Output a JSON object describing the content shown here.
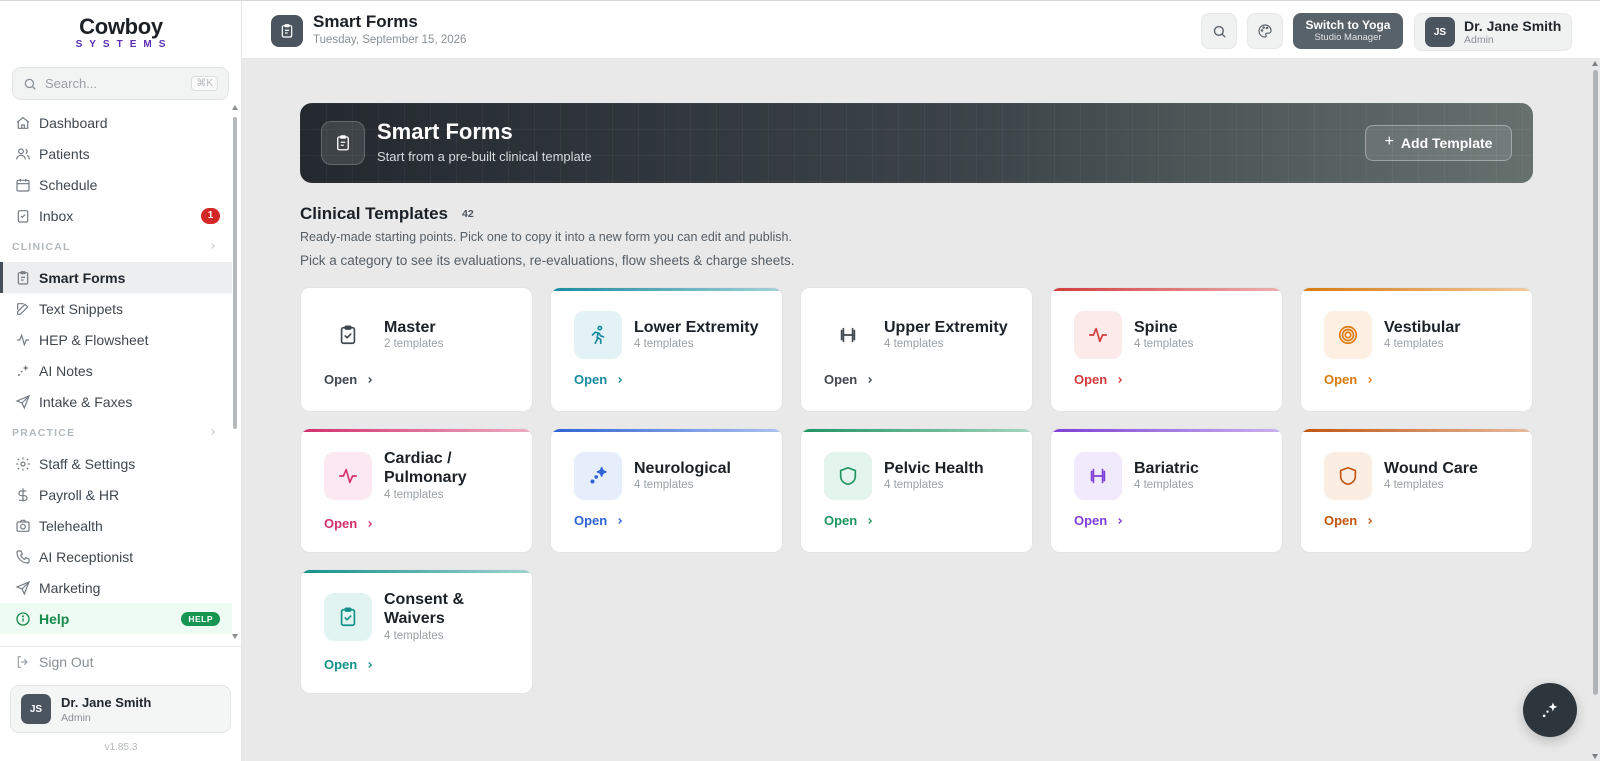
{
  "brand": {
    "name": "Cowboy",
    "sub": "SYSTEMS"
  },
  "search": {
    "placeholder": "Search...",
    "shortcut": "⌘K"
  },
  "nav": {
    "top": [
      {
        "label": "Dashboard",
        "icon": "home-icon"
      },
      {
        "label": "Patients",
        "icon": "users-icon"
      },
      {
        "label": "Schedule",
        "icon": "calendar-icon"
      },
      {
        "label": "Inbox",
        "icon": "inbox-icon",
        "badge": "1"
      }
    ],
    "clinical_label": "CLINICAL",
    "clinical": [
      {
        "label": "Smart Forms",
        "icon": "clipboard-icon",
        "active": true
      },
      {
        "label": "Text Snippets",
        "icon": "edit-icon"
      },
      {
        "label": "HEP & Flowsheet",
        "icon": "activity-icon"
      },
      {
        "label": "AI Notes",
        "icon": "sparkle-icon"
      },
      {
        "label": "Intake & Faxes",
        "icon": "send-icon"
      }
    ],
    "practice_label": "PRACTICE",
    "practice": [
      {
        "label": "Staff & Settings",
        "icon": "gear-icon"
      },
      {
        "label": "Payroll & HR",
        "icon": "dollar-icon"
      },
      {
        "label": "Telehealth",
        "icon": "camera-icon"
      },
      {
        "label": "AI Receptionist",
        "icon": "phone-icon"
      },
      {
        "label": "Marketing",
        "icon": "send-icon"
      }
    ],
    "help": {
      "label": "Help",
      "badge": "HELP"
    },
    "signout": "Sign Out"
  },
  "user": {
    "initials": "JS",
    "name": "Dr. Jane Smith",
    "role": "Admin"
  },
  "version": "v1.85.3",
  "topbar": {
    "title": "Smart Forms",
    "date": "Tuesday, September 15, 2026",
    "switch_line1": "Switch to Yoga",
    "switch_line2": "Studio Manager"
  },
  "hero": {
    "title": "Smart Forms",
    "subtitle": "Start from a pre-built clinical template",
    "add_label": "Add Template"
  },
  "section": {
    "title": "Clinical Templates",
    "count": "42",
    "desc": "Ready-made starting points. Pick one to copy it into a new form you can edit and publish.",
    "desc2": "Pick a category to see its evaluations, re-evaluations, flow sheets & charge sheets."
  },
  "cards": [
    {
      "title": "Master",
      "sub": "2 templates",
      "open": "Open",
      "icon": "clipboard-check-icon",
      "accent": "#ffffff",
      "color": "#3f474f",
      "bg": "#ffffff"
    },
    {
      "title": "Lower Extremity",
      "sub": "4 templates",
      "open": "Open",
      "icon": "running-person-icon",
      "accent": "#1a8ba0",
      "color": "#1a8ba0",
      "bg": "#e3f3f5"
    },
    {
      "title": "Upper Extremity",
      "sub": "4 templates",
      "open": "Open",
      "icon": "dumbbell-icon",
      "accent": "#ffffff",
      "color": "#3f474f",
      "bg": "#ffffff"
    },
    {
      "title": "Spine",
      "sub": "4 templates",
      "open": "Open",
      "icon": "pulse-icon",
      "accent": "#d33b3b",
      "color": "#d33b3b",
      "bg": "#fce9e9"
    },
    {
      "title": "Vestibular",
      "sub": "4 templates",
      "open": "Open",
      "icon": "target-icon",
      "accent": "#d97a0f",
      "color": "#d97a0f",
      "bg": "#fdf0e2"
    },
    {
      "title": "Cardiac / Pulmonary",
      "sub": "4 templates",
      "open": "Open",
      "icon": "pulse-icon",
      "accent": "#d3306a",
      "color": "#d3306a",
      "bg": "#fce8f0"
    },
    {
      "title": "Neurological",
      "sub": "4 templates",
      "open": "Open",
      "icon": "sparkle-icon",
      "accent": "#2f64d6",
      "color": "#2f64d6",
      "bg": "#e6eefc"
    },
    {
      "title": "Pelvic Health",
      "sub": "4 templates",
      "open": "Open",
      "icon": "shield-icon",
      "accent": "#1e9460",
      "color": "#1e9460",
      "bg": "#e3f5ec"
    },
    {
      "title": "Bariatric",
      "sub": "4 templates",
      "open": "Open",
      "icon": "dumbbell-icon",
      "accent": "#7e3fd6",
      "color": "#7e3fd6",
      "bg": "#f1e9fc"
    },
    {
      "title": "Wound Care",
      "sub": "4 templates",
      "open": "Open",
      "icon": "shield-icon",
      "accent": "#c2540f",
      "color": "#c2540f",
      "bg": "#fcede3"
    },
    {
      "title": "Consent & Waivers",
      "sub": "4 templates",
      "open": "Open",
      "icon": "clipboard-check-icon",
      "accent": "#14918a",
      "color": "#14918a",
      "bg": "#e2f4f2"
    }
  ]
}
